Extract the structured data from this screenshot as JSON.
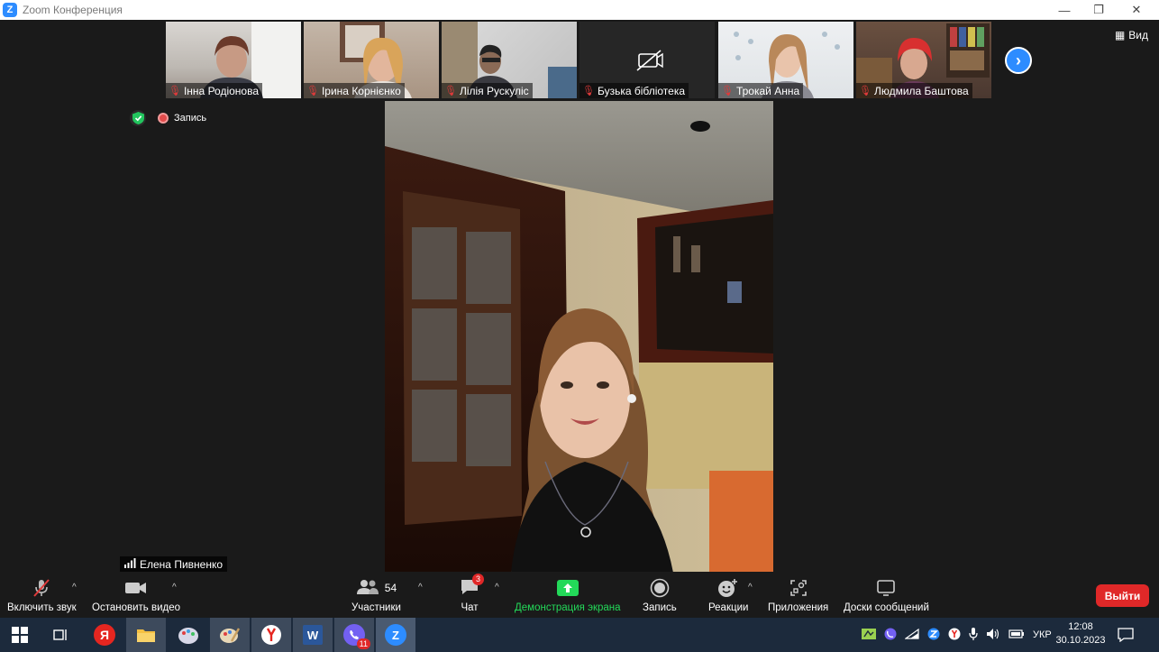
{
  "window": {
    "title": "Zoom Конференция"
  },
  "gallery": {
    "participants": [
      {
        "name": "Інна Родіонова",
        "muted": true,
        "video": true
      },
      {
        "name": "Ірина Корнієнко",
        "muted": true,
        "video": true
      },
      {
        "name": "Лілія Рускуліс",
        "muted": true,
        "video": true
      },
      {
        "name": "Бузька бібліотека",
        "muted": true,
        "video": false
      },
      {
        "name": "Трокай Анна",
        "muted": true,
        "video": true
      },
      {
        "name": "Людмила Баштова",
        "muted": true,
        "video": true
      }
    ],
    "next_icon": "chevron-right-icon"
  },
  "view": {
    "label": "Вид"
  },
  "recording": {
    "label": "Запись"
  },
  "speaker": {
    "name": "Елена Пивненко"
  },
  "toolbar": {
    "unmute_label": "Включить звук",
    "stop_video_label": "Остановить видео",
    "participants_label": "Участники",
    "participants_count": "54",
    "chat_label": "Чат",
    "chat_badge": "3",
    "share_label": "Демонстрация экрана",
    "record_label": "Запись",
    "reactions_label": "Реакции",
    "apps_label": "Приложения",
    "whiteboards_label": "Доски сообщений",
    "exit_label": "Выйти"
  },
  "taskbar": {
    "yandex_letter": "Я",
    "word_letter": "W",
    "zoom_letter": "Z",
    "viber_badge": "11",
    "lang": "УКР",
    "time": "12:08",
    "date": "30.10.2023"
  },
  "colors": {
    "accent": "#2d8cff",
    "share_green": "#23d959",
    "exit_red": "#e02828",
    "muted_red": "#e03a3a",
    "taskbar": "#1c2a3c"
  }
}
